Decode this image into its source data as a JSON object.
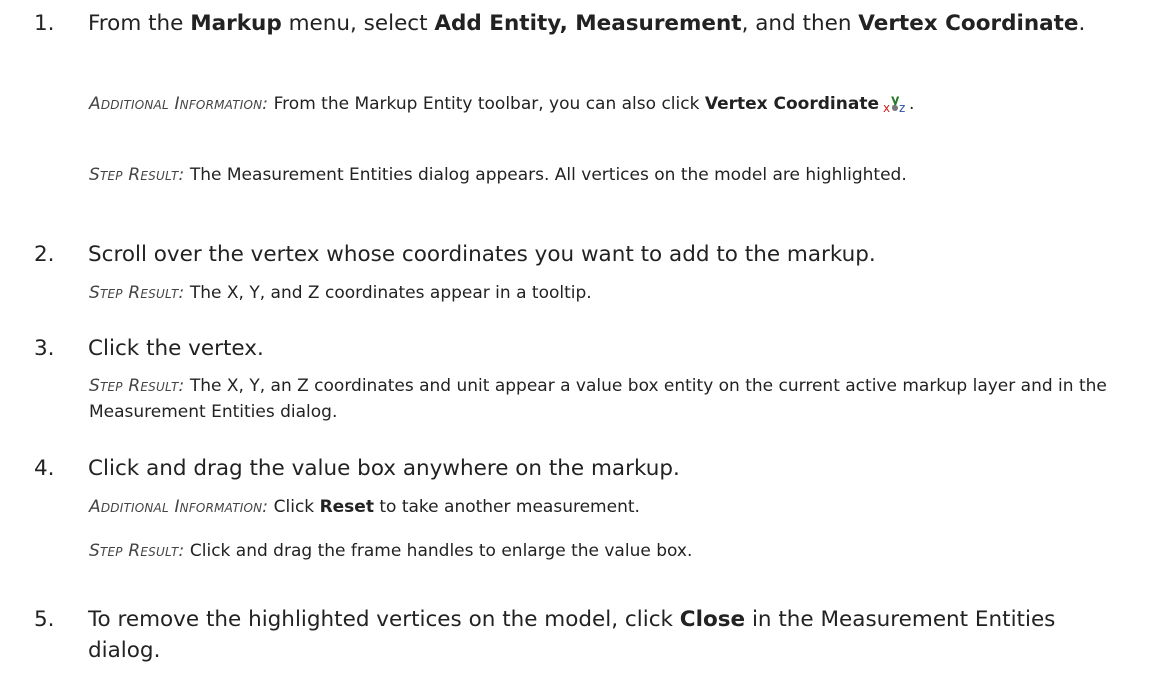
{
  "steps": [
    {
      "num": "1.",
      "pre": "From the ",
      "b1": "Markup",
      "mid1": " menu, select ",
      "b2": "Add Entity, Measurement",
      "mid2": ", and then ",
      "b3": "Vertex Coordinate",
      "post": ".",
      "note1_label": "Additional Information:",
      "note1_pre": " From the Markup Entity toolbar, you can also click ",
      "note1_bold": "Vertex Coordinate",
      "note1_post": ".",
      "note2_label": "Step Result:",
      "note2_text": " The Measurement Entities dialog appears. All vertices on the model are highlighted."
    },
    {
      "num": "2.",
      "text": "Scroll over the vertex whose coordinates you want to add to the markup.",
      "note1_label": "Step Result:",
      "note1_text": " The X, Y, and Z coordinates appear in a tooltip."
    },
    {
      "num": "3.",
      "text": "Click the vertex.",
      "note1_label": "Step Result:",
      "note1_text": " The X, Y, an Z coordinates and unit appear a value box entity on the current active markup layer and in the Measurement Entities dialog."
    },
    {
      "num": "4.",
      "text": "Click and drag the value box anywhere on the markup.",
      "note1_label": "Additional Information:",
      "note1_pre": " Click ",
      "note1_bold": "Reset",
      "note1_post": " to take another measurement.",
      "note2_label": "Step Result:",
      "note2_text": " Click and drag the frame handles to enlarge the value box."
    },
    {
      "num": "5.",
      "pre": "To remove the highlighted vertices on the model, click ",
      "bold": "Close",
      "post": " in the Measurement Entities dialog."
    }
  ],
  "icons": {
    "vertex_coordinate": "xyz-vertex-icon",
    "x": "x",
    "y": "y",
    "z": "z"
  }
}
